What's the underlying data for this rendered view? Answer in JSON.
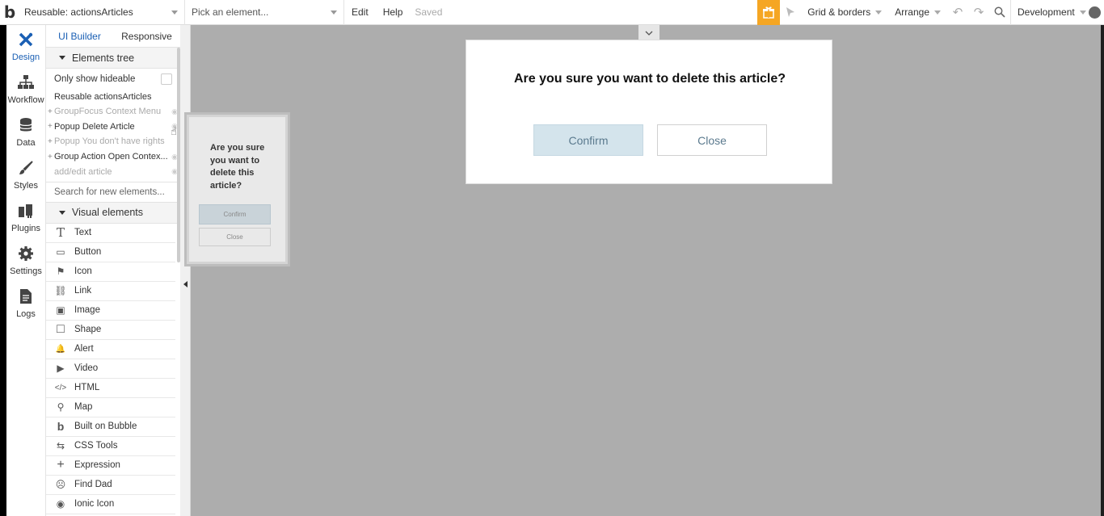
{
  "topbar": {
    "logo": "b",
    "page_selector": "Reusable: actionsArticles",
    "element_picker_placeholder": "Pick an element...",
    "menu_edit": "Edit",
    "menu_help": "Help",
    "status": "Saved",
    "grid_borders": "Grid & borders",
    "arrange": "Arrange",
    "environment": "Development"
  },
  "iconbar": {
    "items": [
      {
        "label": "Design",
        "icon": "design-icon"
      },
      {
        "label": "Workflow",
        "icon": "workflow-icon"
      },
      {
        "label": "Data",
        "icon": "database-icon"
      },
      {
        "label": "Styles",
        "icon": "brush-icon"
      },
      {
        "label": "Plugins",
        "icon": "plug-icon"
      },
      {
        "label": "Settings",
        "icon": "gear-icon"
      },
      {
        "label": "Logs",
        "icon": "document-icon"
      }
    ]
  },
  "panel": {
    "tab_ui_builder": "UI Builder",
    "tab_responsive": "Responsive",
    "elements_tree": "Elements tree",
    "only_show_hideable": "Only show hideable",
    "tree_root": "Reusable actionsArticles",
    "tree_items": [
      {
        "label": "GroupFocus Context Menu"
      },
      {
        "label": "Popup Delete Article"
      },
      {
        "label": "Popup You don't have rights"
      },
      {
        "label": "Group Action Open Contex..."
      },
      {
        "label": "add/edit article"
      }
    ],
    "search_placeholder": "Search for new elements...",
    "visual_elements": "Visual elements",
    "visual_items": [
      {
        "label": "Text",
        "icon": "T"
      },
      {
        "label": "Button",
        "icon": "▭"
      },
      {
        "label": "Icon",
        "icon": "⚑"
      },
      {
        "label": "Link",
        "icon": "⛓"
      },
      {
        "label": "Image",
        "icon": "▣"
      },
      {
        "label": "Shape",
        "icon": "□"
      },
      {
        "label": "Alert",
        "icon": "🔔"
      },
      {
        "label": "Video",
        "icon": "▶"
      },
      {
        "label": "HTML",
        "icon": "</>"
      },
      {
        "label": "Map",
        "icon": "⚲"
      },
      {
        "label": "Built on Bubble",
        "icon": "b"
      },
      {
        "label": "CSS Tools",
        "icon": "⇆"
      },
      {
        "label": "Expression",
        "icon": "+"
      },
      {
        "label": "Find Dad",
        "icon": "☹"
      },
      {
        "label": "Ionic Icon",
        "icon": "◉"
      }
    ]
  },
  "popup": {
    "title": "Are you sure you want to delete this article?",
    "confirm": "Confirm",
    "close": "Close"
  },
  "preview": {
    "text": "Are you sure you want to delete this article?",
    "confirm": "Confirm",
    "close": "Close"
  }
}
